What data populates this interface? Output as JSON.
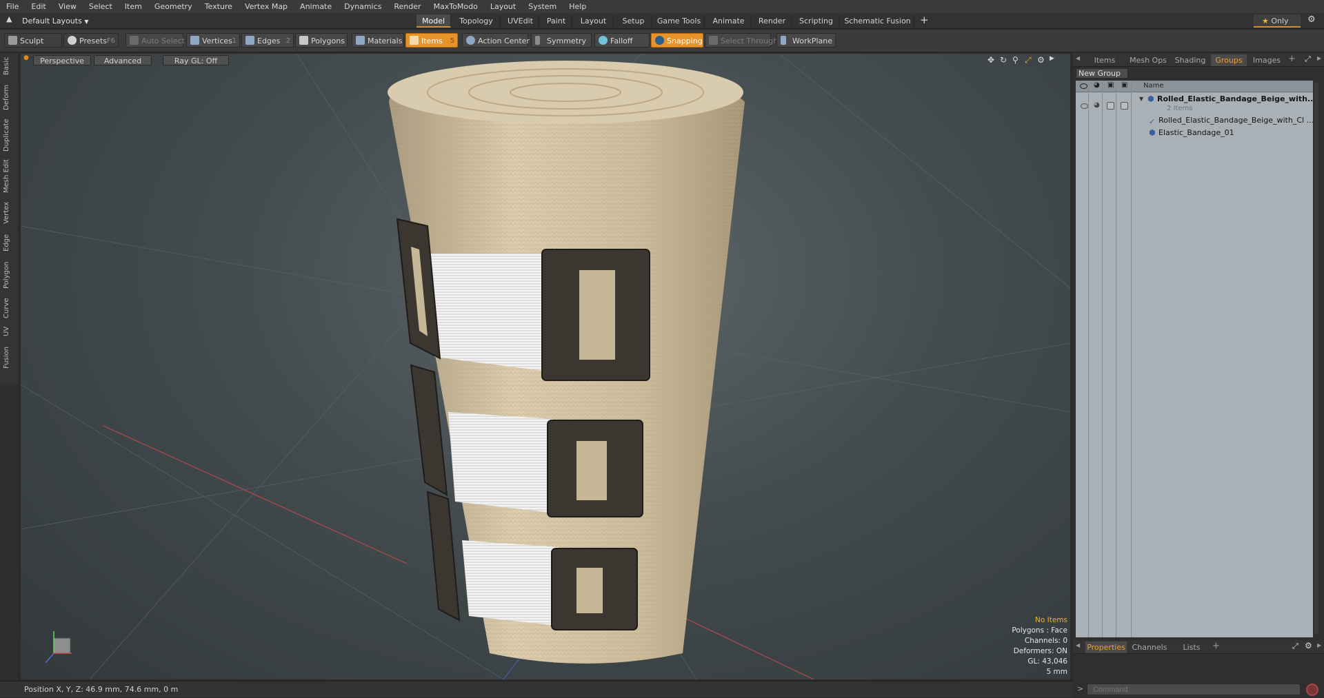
{
  "menu": [
    "File",
    "Edit",
    "View",
    "Select",
    "Item",
    "Geometry",
    "Texture",
    "Vertex Map",
    "Animate",
    "Dynamics",
    "Render",
    "MaxToModo",
    "Layout",
    "System",
    "Help"
  ],
  "layout_selector": "Default Layouts",
  "layout_tabs": [
    "Model",
    "Topology",
    "UVEdit",
    "Paint",
    "Layout",
    "Setup",
    "Game Tools",
    "Animate",
    "Render",
    "Scripting",
    "Schematic Fusion"
  ],
  "only_label": "Only",
  "toolbar": {
    "sculpt": "Sculpt",
    "presets": "Presets",
    "presets_key": "F6",
    "auto_select": "Auto Select",
    "vertices": "Vertices",
    "vertices_num": "1",
    "edges": "Edges",
    "edges_num": "2",
    "polygons": "Polygons",
    "materials": "Materials",
    "items": "Items",
    "items_num": "5",
    "action_center": "Action Center",
    "symmetry": "Symmetry",
    "falloff": "Falloff",
    "snapping": "Snapping",
    "select_through": "Select Through",
    "workplane": "WorkPlane"
  },
  "left_tabs": [
    "Basic",
    "Deform",
    "Duplicate",
    "Mesh Edit",
    "Vertex",
    "Edge",
    "Polygon",
    "Curve",
    "UV",
    "Fusion"
  ],
  "viewport": {
    "view": "Perspective",
    "shading": "Advanced",
    "raygl": "Ray GL: Off",
    "info": {
      "selection": "No Items",
      "polygons": "Polygons : Face",
      "channels": "Channels: 0",
      "deformers": "Deformers: ON",
      "gl": "GL: 43,046",
      "grid": "5 mm"
    }
  },
  "status": "Position X, Y, Z:   46.9 mm, 74.6 mm, 0 m",
  "right_panel": {
    "tabs": [
      "Items",
      "Mesh Ops",
      "Shading",
      "Groups",
      "Images"
    ],
    "new_group": "New Group",
    "column_name": "Name",
    "group_name": "Rolled_Elastic_Bandage_Beige_with...",
    "group_count": "2 Items",
    "child1": "Rolled_Elastic_Bandage_Beige_with_Cl ...",
    "child2": "Elastic_Bandage_01",
    "bottom_tabs": [
      "Properties",
      "Channels",
      "Lists"
    ],
    "command_placeholder": "Command"
  },
  "colors": {
    "accent": "#e8932a",
    "highlight": "#f2b230"
  }
}
